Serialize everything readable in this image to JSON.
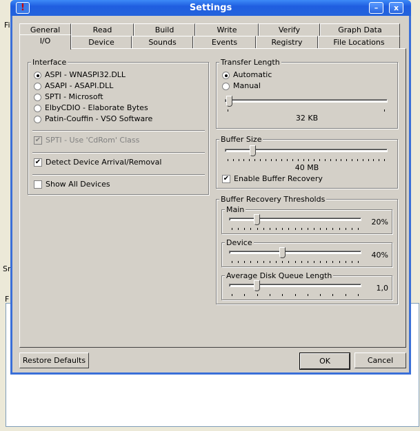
{
  "background": {
    "menu_fragment": "Fi",
    "status_fragment": "Sr",
    "menu2_fragment": "F"
  },
  "window": {
    "title": "Settings",
    "minimize_label": "–",
    "close_label": "x"
  },
  "tabs_row1": [
    "General",
    "Read",
    "Build",
    "Write",
    "Verify",
    "Graph Data"
  ],
  "tabs_row2": [
    "I/O",
    "Device",
    "Sounds",
    "Events",
    "Registry",
    "File Locations"
  ],
  "active_tab": "I/O",
  "interface": {
    "label": "Interface",
    "options": [
      "ASPI - WNASPI32.DLL",
      "ASAPI - ASAPI.DLL",
      "SPTI - Microsoft",
      "ElbyCDIO - Elaborate Bytes",
      "Patin-Couffin - VSO Software"
    ],
    "selected": 0,
    "spti_cdrom": "SPTI - Use 'CdRom' Class",
    "detect_arrival": "Detect Device Arrival/Removal",
    "show_all": "Show All Devices"
  },
  "transfer": {
    "label": "Transfer Length",
    "automatic": "Automatic",
    "manual": "Manual",
    "selected": "Automatic",
    "value_label": "32 KB",
    "slider_fraction": 0.01
  },
  "buffer": {
    "label": "Buffer Size",
    "value_label": "40 MB",
    "slider_fraction": 0.16,
    "enable_recovery": "Enable Buffer Recovery",
    "enable_recovery_checked": true
  },
  "thresholds": {
    "label": "Buffer Recovery Thresholds",
    "main": {
      "label": "Main",
      "value_label": "20%",
      "fraction": 0.2
    },
    "device": {
      "label": "Device",
      "value_label": "40%",
      "fraction": 0.4
    },
    "queue": {
      "label": "Average Disk Queue Length",
      "value_label": "1,0",
      "fraction": 0.2
    }
  },
  "buttons": {
    "restore": "Restore Defaults",
    "ok": "OK",
    "cancel": "Cancel"
  }
}
